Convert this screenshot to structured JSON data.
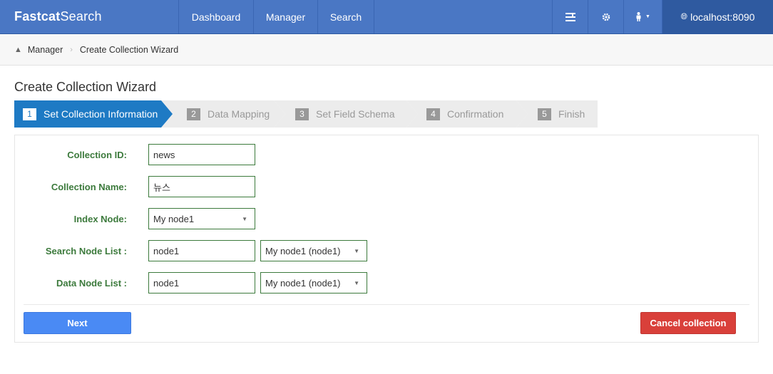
{
  "brand": {
    "part1": "Fastcat",
    "part2": "Search"
  },
  "nav": {
    "items": [
      {
        "label": "Dashboard"
      },
      {
        "label": "Manager"
      },
      {
        "label": "Search"
      }
    ],
    "host": "localhost:8090",
    "icons": [
      "list-icon",
      "gear-icon",
      "user-icon",
      "globe-icon"
    ]
  },
  "breadcrumb": {
    "section": "Manager",
    "current": "Create Collection Wizard"
  },
  "page": {
    "title": "Create Collection Wizard"
  },
  "steps": [
    {
      "num": "1",
      "label": "Set Collection Information",
      "active": true
    },
    {
      "num": "2",
      "label": "Data Mapping",
      "active": false
    },
    {
      "num": "3",
      "label": "Set Field Schema",
      "active": false
    },
    {
      "num": "4",
      "label": "Confirmation",
      "active": false
    },
    {
      "num": "5",
      "label": "Finish",
      "active": false
    }
  ],
  "form": {
    "collection_id": {
      "label": "Collection ID:",
      "value": "news"
    },
    "collection_name": {
      "label": "Collection Name:",
      "value": "뉴스"
    },
    "index_node": {
      "label": "Index Node:",
      "value": "My node1"
    },
    "search_node_list": {
      "label": "Search Node List :",
      "value": "node1",
      "select": "My node1 (node1)"
    },
    "data_node_list": {
      "label": "Data Node List :",
      "value": "node1",
      "select": "My node1 (node1)"
    }
  },
  "buttons": {
    "next": "Next",
    "cancel": "Cancel collection"
  },
  "colors": {
    "navbar": "#4a77c4",
    "active_step": "#1e7ac4",
    "label_green": "#3c7a3c",
    "next": "#4a8af4",
    "cancel": "#d9403a"
  }
}
